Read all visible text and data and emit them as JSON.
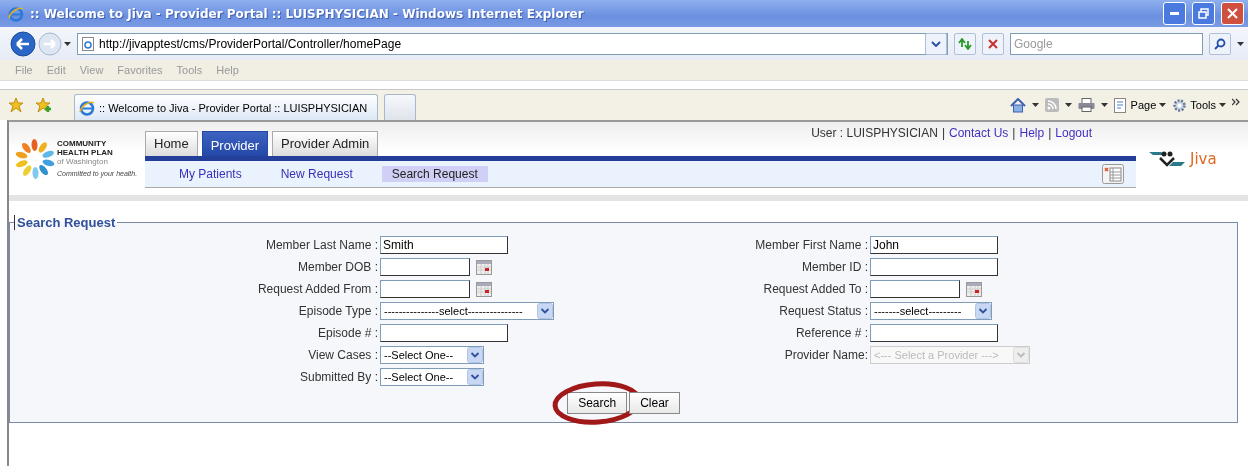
{
  "browser": {
    "title": ":: Welcome to Jiva - Provider Portal :: LUISPHYSICIAN - Windows Internet Explorer",
    "address": "http://jivapptest/cms/ProviderPortal/Controller/homePage",
    "search_placeholder": "Google",
    "menu": [
      "File",
      "Edit",
      "View",
      "Favorites",
      "Tools",
      "Help"
    ],
    "tab_title": ":: Welcome to Jiva - Provider Portal :: LUISPHYSICIAN",
    "toolbar": [
      "Page",
      "Tools"
    ]
  },
  "header": {
    "logo": {
      "line1": "COMMUNITY",
      "line2": "HEALTH PLAN",
      "line3": "of Washington",
      "tagline": "Committed to your health."
    },
    "tabs": [
      {
        "label": "Home",
        "selected": false
      },
      {
        "label": "Provider",
        "selected": true
      },
      {
        "label": "Provider Admin",
        "selected": false
      }
    ],
    "subnav": [
      {
        "label": "My Patients",
        "selected": false
      },
      {
        "label": "New Request",
        "selected": false
      },
      {
        "label": "Search Request",
        "selected": true
      }
    ],
    "user_label": "User : LUISPHYSICIAN",
    "separator": "|",
    "links": [
      "Contact Us",
      "Help",
      "Logout"
    ],
    "brand": "Jiva"
  },
  "form": {
    "legend": "Search Request",
    "left": [
      {
        "label": "Member Last Name :",
        "kind": "text",
        "value": "Smith"
      },
      {
        "label": "Member DOB :",
        "kind": "date"
      },
      {
        "label": "Request Added From :",
        "kind": "date"
      },
      {
        "label": "Episode Type :",
        "kind": "select",
        "value": "---------------select---------------"
      },
      {
        "label": "Episode # :",
        "kind": "text"
      },
      {
        "label": "View Cases :",
        "kind": "select",
        "value": "--Select One--"
      },
      {
        "label": "Submitted By :",
        "kind": "select",
        "value": "--Select One--"
      }
    ],
    "right": [
      {
        "label": "Member First Name :",
        "kind": "text",
        "value": "John"
      },
      {
        "label": "Member ID :",
        "kind": "text"
      },
      {
        "label": "Request Added To :",
        "kind": "date"
      },
      {
        "label": "Request Status :",
        "kind": "select",
        "value": "-------select---------"
      },
      {
        "label": "Reference # :",
        "kind": "text"
      },
      {
        "label": "Provider Name:",
        "kind": "select",
        "value": "<--- Select a Provider --->",
        "disabled": true
      }
    ],
    "buttons": [
      {
        "label": "Search",
        "highlighted": true
      },
      {
        "label": "Clear",
        "highlighted": false
      }
    ]
  }
}
